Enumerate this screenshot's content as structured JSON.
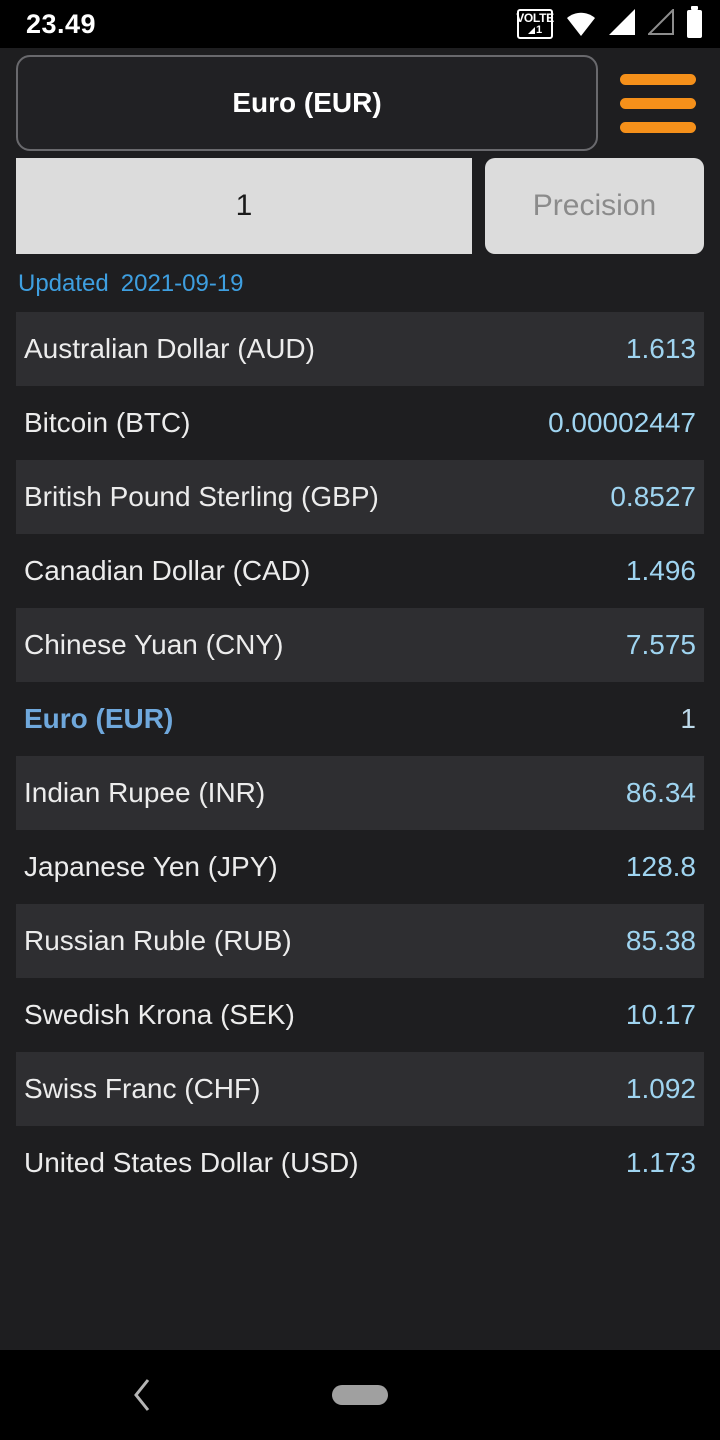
{
  "statusbar": {
    "time": "23.49",
    "icons": [
      "volte-icon",
      "wifi-icon",
      "signal-full-icon",
      "signal-empty-icon",
      "battery-icon"
    ],
    "volte_text": "VOLTE",
    "volte_sim": "1"
  },
  "header": {
    "selected_currency": "Euro (EUR)",
    "menu_icon": "hamburger-menu-icon",
    "menu_color": "#f5901a"
  },
  "amount": {
    "value": "1",
    "precision_label": "Precision"
  },
  "updated": {
    "label": "Updated",
    "date": "2021-09-19",
    "color": "#3e9fe0"
  },
  "rates": [
    {
      "name": "Australian Dollar (AUD)",
      "value": "1.613",
      "striped": true,
      "selected": false
    },
    {
      "name": "Bitcoin (BTC)",
      "value": "0.00002447",
      "striped": false,
      "selected": false
    },
    {
      "name": "British Pound Sterling (GBP)",
      "value": "0.8527",
      "striped": true,
      "selected": false
    },
    {
      "name": "Canadian Dollar (CAD)",
      "value": "1.496",
      "striped": false,
      "selected": false
    },
    {
      "name": "Chinese Yuan (CNY)",
      "value": "7.575",
      "striped": true,
      "selected": false
    },
    {
      "name": "Euro (EUR)",
      "value": "1",
      "striped": false,
      "selected": true
    },
    {
      "name": "Indian Rupee (INR)",
      "value": "86.34",
      "striped": true,
      "selected": false
    },
    {
      "name": "Japanese Yen (JPY)",
      "value": "128.8",
      "striped": false,
      "selected": false
    },
    {
      "name": "Russian Ruble (RUB)",
      "value": "85.38",
      "striped": true,
      "selected": false
    },
    {
      "name": "Swedish Krona (SEK)",
      "value": "10.17",
      "striped": false,
      "selected": false
    },
    {
      "name": "Swiss Franc (CHF)",
      "value": "1.092",
      "striped": true,
      "selected": false
    },
    {
      "name": "United States Dollar (USD)",
      "value": "1.173",
      "striped": false,
      "selected": false
    }
  ],
  "navbar": {
    "back_icon": "chevron-left-icon",
    "home_pill": "home-handle"
  }
}
